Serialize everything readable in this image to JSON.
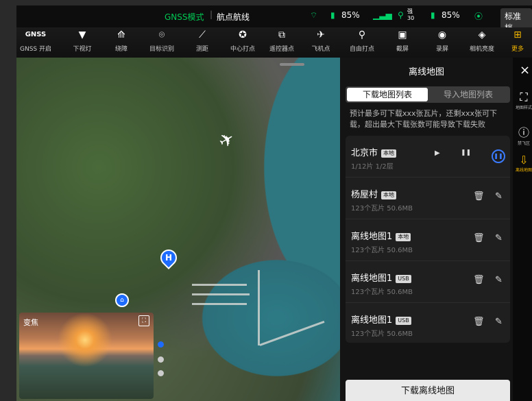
{
  "status": {
    "mode": "GNSS模式",
    "route": "航点航线",
    "wifi_pct": "85%",
    "signal": "",
    "gps_label": "强",
    "gps_num": "30",
    "rc_pct": "85%",
    "profile": "标准档"
  },
  "toolbar": [
    {
      "label": "GNSS 开启",
      "icon": "GNSS"
    },
    {
      "label": "下视灯",
      "icon": "▼"
    },
    {
      "label": "绕障",
      "icon": "⟰"
    },
    {
      "label": "目标识别",
      "icon": "⌾"
    },
    {
      "label": "测距",
      "icon": "⟋"
    },
    {
      "label": "中心打点",
      "icon": "✪"
    },
    {
      "label": "遥控器点",
      "icon": "⧉"
    },
    {
      "label": "飞机点",
      "icon": "✈"
    },
    {
      "label": "自由打点",
      "icon": "⚲"
    },
    {
      "label": "截屏",
      "icon": "▣"
    },
    {
      "label": "录屏",
      "icon": "◉"
    },
    {
      "label": "相机亮度",
      "icon": "◈"
    },
    {
      "label": "更多",
      "icon": "⊞"
    }
  ],
  "mini_view": {
    "label": "变焦"
  },
  "panel": {
    "title": "离线地图",
    "tab_download": "下载地图列表",
    "tab_import": "导入地图列表",
    "hint": "预计最多可下载xxx张瓦片，还剩xxx张可下载，超出最大下载张数可能导致下载失败",
    "maps": [
      {
        "name": "北京市",
        "tag": "本地",
        "sub": "1/12片  1/2层"
      },
      {
        "name": "杨屋村",
        "tag": "本地",
        "sub": "123个瓦片 50.6MB"
      },
      {
        "name": "离线地图1",
        "tag": "本地",
        "sub": "123个瓦片 50.6MB"
      },
      {
        "name": "离线地图1",
        "tag": "USB",
        "sub": "123个瓦片 50.6MB"
      },
      {
        "name": "离线地图1",
        "tag": "USB",
        "sub": "123个瓦片 50.6MB"
      }
    ],
    "download_button": "下载离线地图"
  },
  "rail": {
    "close": "×",
    "items": [
      {
        "label": "地图样式",
        "icon": "⛶"
      },
      {
        "label": "禁飞区",
        "icon": "ⓘ"
      },
      {
        "label": "离线地图",
        "icon": "⇩"
      }
    ]
  },
  "colors": {
    "accent_yellow": "#f0b400",
    "accent_blue": "#3a7bff",
    "gnss_green": "#00c853"
  }
}
